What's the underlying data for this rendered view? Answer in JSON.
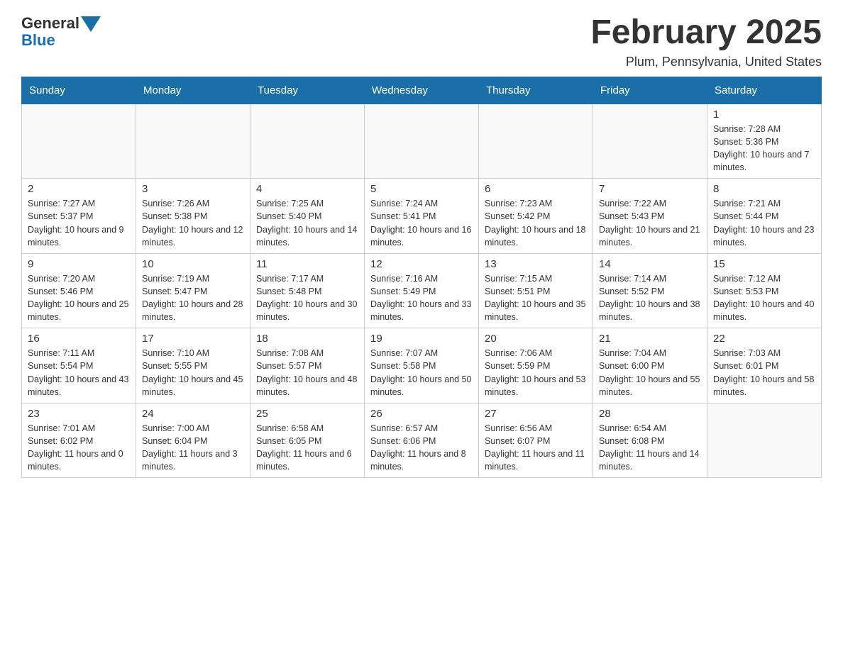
{
  "logo": {
    "general": "General",
    "blue": "Blue"
  },
  "header": {
    "month_title": "February 2025",
    "location": "Plum, Pennsylvania, United States"
  },
  "weekdays": [
    "Sunday",
    "Monday",
    "Tuesday",
    "Wednesday",
    "Thursday",
    "Friday",
    "Saturday"
  ],
  "weeks": [
    [
      {
        "day": "",
        "info": ""
      },
      {
        "day": "",
        "info": ""
      },
      {
        "day": "",
        "info": ""
      },
      {
        "day": "",
        "info": ""
      },
      {
        "day": "",
        "info": ""
      },
      {
        "day": "",
        "info": ""
      },
      {
        "day": "1",
        "info": "Sunrise: 7:28 AM\nSunset: 5:36 PM\nDaylight: 10 hours and 7 minutes."
      }
    ],
    [
      {
        "day": "2",
        "info": "Sunrise: 7:27 AM\nSunset: 5:37 PM\nDaylight: 10 hours and 9 minutes."
      },
      {
        "day": "3",
        "info": "Sunrise: 7:26 AM\nSunset: 5:38 PM\nDaylight: 10 hours and 12 minutes."
      },
      {
        "day": "4",
        "info": "Sunrise: 7:25 AM\nSunset: 5:40 PM\nDaylight: 10 hours and 14 minutes."
      },
      {
        "day": "5",
        "info": "Sunrise: 7:24 AM\nSunset: 5:41 PM\nDaylight: 10 hours and 16 minutes."
      },
      {
        "day": "6",
        "info": "Sunrise: 7:23 AM\nSunset: 5:42 PM\nDaylight: 10 hours and 18 minutes."
      },
      {
        "day": "7",
        "info": "Sunrise: 7:22 AM\nSunset: 5:43 PM\nDaylight: 10 hours and 21 minutes."
      },
      {
        "day": "8",
        "info": "Sunrise: 7:21 AM\nSunset: 5:44 PM\nDaylight: 10 hours and 23 minutes."
      }
    ],
    [
      {
        "day": "9",
        "info": "Sunrise: 7:20 AM\nSunset: 5:46 PM\nDaylight: 10 hours and 25 minutes."
      },
      {
        "day": "10",
        "info": "Sunrise: 7:19 AM\nSunset: 5:47 PM\nDaylight: 10 hours and 28 minutes."
      },
      {
        "day": "11",
        "info": "Sunrise: 7:17 AM\nSunset: 5:48 PM\nDaylight: 10 hours and 30 minutes."
      },
      {
        "day": "12",
        "info": "Sunrise: 7:16 AM\nSunset: 5:49 PM\nDaylight: 10 hours and 33 minutes."
      },
      {
        "day": "13",
        "info": "Sunrise: 7:15 AM\nSunset: 5:51 PM\nDaylight: 10 hours and 35 minutes."
      },
      {
        "day": "14",
        "info": "Sunrise: 7:14 AM\nSunset: 5:52 PM\nDaylight: 10 hours and 38 minutes."
      },
      {
        "day": "15",
        "info": "Sunrise: 7:12 AM\nSunset: 5:53 PM\nDaylight: 10 hours and 40 minutes."
      }
    ],
    [
      {
        "day": "16",
        "info": "Sunrise: 7:11 AM\nSunset: 5:54 PM\nDaylight: 10 hours and 43 minutes."
      },
      {
        "day": "17",
        "info": "Sunrise: 7:10 AM\nSunset: 5:55 PM\nDaylight: 10 hours and 45 minutes."
      },
      {
        "day": "18",
        "info": "Sunrise: 7:08 AM\nSunset: 5:57 PM\nDaylight: 10 hours and 48 minutes."
      },
      {
        "day": "19",
        "info": "Sunrise: 7:07 AM\nSunset: 5:58 PM\nDaylight: 10 hours and 50 minutes."
      },
      {
        "day": "20",
        "info": "Sunrise: 7:06 AM\nSunset: 5:59 PM\nDaylight: 10 hours and 53 minutes."
      },
      {
        "day": "21",
        "info": "Sunrise: 7:04 AM\nSunset: 6:00 PM\nDaylight: 10 hours and 55 minutes."
      },
      {
        "day": "22",
        "info": "Sunrise: 7:03 AM\nSunset: 6:01 PM\nDaylight: 10 hours and 58 minutes."
      }
    ],
    [
      {
        "day": "23",
        "info": "Sunrise: 7:01 AM\nSunset: 6:02 PM\nDaylight: 11 hours and 0 minutes."
      },
      {
        "day": "24",
        "info": "Sunrise: 7:00 AM\nSunset: 6:04 PM\nDaylight: 11 hours and 3 minutes."
      },
      {
        "day": "25",
        "info": "Sunrise: 6:58 AM\nSunset: 6:05 PM\nDaylight: 11 hours and 6 minutes."
      },
      {
        "day": "26",
        "info": "Sunrise: 6:57 AM\nSunset: 6:06 PM\nDaylight: 11 hours and 8 minutes."
      },
      {
        "day": "27",
        "info": "Sunrise: 6:56 AM\nSunset: 6:07 PM\nDaylight: 11 hours and 11 minutes."
      },
      {
        "day": "28",
        "info": "Sunrise: 6:54 AM\nSunset: 6:08 PM\nDaylight: 11 hours and 14 minutes."
      },
      {
        "day": "",
        "info": ""
      }
    ]
  ]
}
